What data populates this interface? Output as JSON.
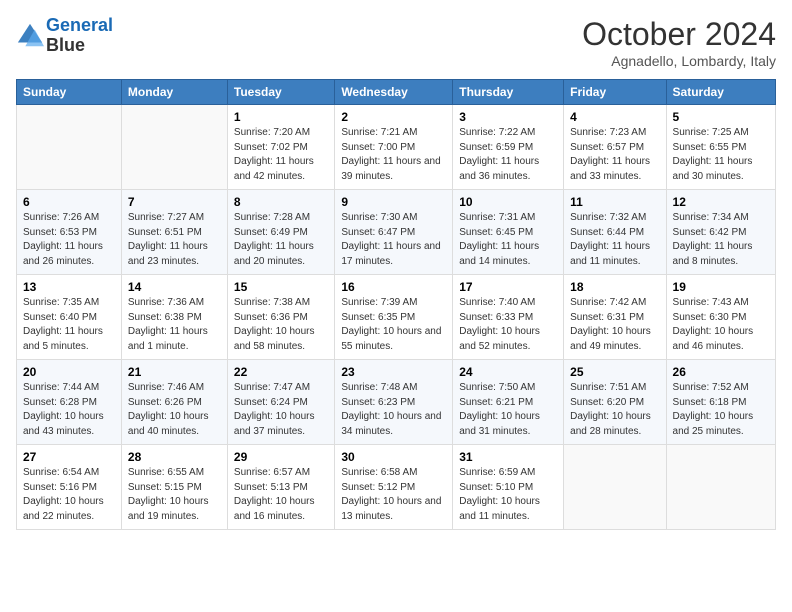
{
  "header": {
    "logo_line1": "General",
    "logo_line2": "Blue",
    "month_title": "October 2024",
    "location": "Agnadello, Lombardy, Italy"
  },
  "weekdays": [
    "Sunday",
    "Monday",
    "Tuesday",
    "Wednesday",
    "Thursday",
    "Friday",
    "Saturday"
  ],
  "weeks": [
    [
      {
        "day": "",
        "info": ""
      },
      {
        "day": "",
        "info": ""
      },
      {
        "day": "1",
        "info": "Sunrise: 7:20 AM\nSunset: 7:02 PM\nDaylight: 11 hours and 42 minutes."
      },
      {
        "day": "2",
        "info": "Sunrise: 7:21 AM\nSunset: 7:00 PM\nDaylight: 11 hours and 39 minutes."
      },
      {
        "day": "3",
        "info": "Sunrise: 7:22 AM\nSunset: 6:59 PM\nDaylight: 11 hours and 36 minutes."
      },
      {
        "day": "4",
        "info": "Sunrise: 7:23 AM\nSunset: 6:57 PM\nDaylight: 11 hours and 33 minutes."
      },
      {
        "day": "5",
        "info": "Sunrise: 7:25 AM\nSunset: 6:55 PM\nDaylight: 11 hours and 30 minutes."
      }
    ],
    [
      {
        "day": "6",
        "info": "Sunrise: 7:26 AM\nSunset: 6:53 PM\nDaylight: 11 hours and 26 minutes."
      },
      {
        "day": "7",
        "info": "Sunrise: 7:27 AM\nSunset: 6:51 PM\nDaylight: 11 hours and 23 minutes."
      },
      {
        "day": "8",
        "info": "Sunrise: 7:28 AM\nSunset: 6:49 PM\nDaylight: 11 hours and 20 minutes."
      },
      {
        "day": "9",
        "info": "Sunrise: 7:30 AM\nSunset: 6:47 PM\nDaylight: 11 hours and 17 minutes."
      },
      {
        "day": "10",
        "info": "Sunrise: 7:31 AM\nSunset: 6:45 PM\nDaylight: 11 hours and 14 minutes."
      },
      {
        "day": "11",
        "info": "Sunrise: 7:32 AM\nSunset: 6:44 PM\nDaylight: 11 hours and 11 minutes."
      },
      {
        "day": "12",
        "info": "Sunrise: 7:34 AM\nSunset: 6:42 PM\nDaylight: 11 hours and 8 minutes."
      }
    ],
    [
      {
        "day": "13",
        "info": "Sunrise: 7:35 AM\nSunset: 6:40 PM\nDaylight: 11 hours and 5 minutes."
      },
      {
        "day": "14",
        "info": "Sunrise: 7:36 AM\nSunset: 6:38 PM\nDaylight: 11 hours and 1 minute."
      },
      {
        "day": "15",
        "info": "Sunrise: 7:38 AM\nSunset: 6:36 PM\nDaylight: 10 hours and 58 minutes."
      },
      {
        "day": "16",
        "info": "Sunrise: 7:39 AM\nSunset: 6:35 PM\nDaylight: 10 hours and 55 minutes."
      },
      {
        "day": "17",
        "info": "Sunrise: 7:40 AM\nSunset: 6:33 PM\nDaylight: 10 hours and 52 minutes."
      },
      {
        "day": "18",
        "info": "Sunrise: 7:42 AM\nSunset: 6:31 PM\nDaylight: 10 hours and 49 minutes."
      },
      {
        "day": "19",
        "info": "Sunrise: 7:43 AM\nSunset: 6:30 PM\nDaylight: 10 hours and 46 minutes."
      }
    ],
    [
      {
        "day": "20",
        "info": "Sunrise: 7:44 AM\nSunset: 6:28 PM\nDaylight: 10 hours and 43 minutes."
      },
      {
        "day": "21",
        "info": "Sunrise: 7:46 AM\nSunset: 6:26 PM\nDaylight: 10 hours and 40 minutes."
      },
      {
        "day": "22",
        "info": "Sunrise: 7:47 AM\nSunset: 6:24 PM\nDaylight: 10 hours and 37 minutes."
      },
      {
        "day": "23",
        "info": "Sunrise: 7:48 AM\nSunset: 6:23 PM\nDaylight: 10 hours and 34 minutes."
      },
      {
        "day": "24",
        "info": "Sunrise: 7:50 AM\nSunset: 6:21 PM\nDaylight: 10 hours and 31 minutes."
      },
      {
        "day": "25",
        "info": "Sunrise: 7:51 AM\nSunset: 6:20 PM\nDaylight: 10 hours and 28 minutes."
      },
      {
        "day": "26",
        "info": "Sunrise: 7:52 AM\nSunset: 6:18 PM\nDaylight: 10 hours and 25 minutes."
      }
    ],
    [
      {
        "day": "27",
        "info": "Sunrise: 6:54 AM\nSunset: 5:16 PM\nDaylight: 10 hours and 22 minutes."
      },
      {
        "day": "28",
        "info": "Sunrise: 6:55 AM\nSunset: 5:15 PM\nDaylight: 10 hours and 19 minutes."
      },
      {
        "day": "29",
        "info": "Sunrise: 6:57 AM\nSunset: 5:13 PM\nDaylight: 10 hours and 16 minutes."
      },
      {
        "day": "30",
        "info": "Sunrise: 6:58 AM\nSunset: 5:12 PM\nDaylight: 10 hours and 13 minutes."
      },
      {
        "day": "31",
        "info": "Sunrise: 6:59 AM\nSunset: 5:10 PM\nDaylight: 10 hours and 11 minutes."
      },
      {
        "day": "",
        "info": ""
      },
      {
        "day": "",
        "info": ""
      }
    ]
  ]
}
